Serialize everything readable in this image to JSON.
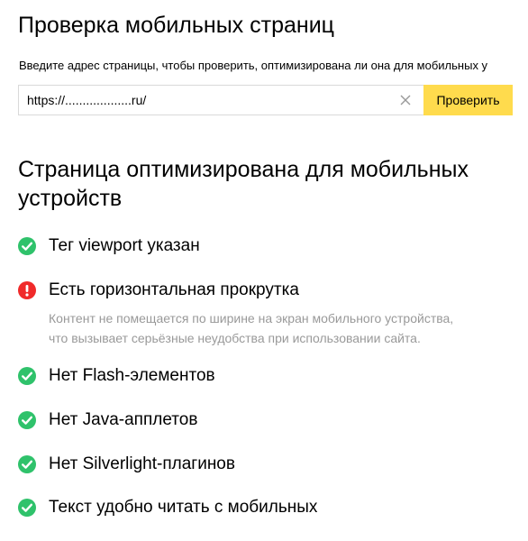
{
  "header": {
    "title": "Проверка мобильных страниц"
  },
  "form": {
    "instruction": "Введите адрес страницы, чтобы проверить, оптимизирована ли она для мобильных у",
    "url_value": "https://...................ru/",
    "clear_icon": "close-icon",
    "submit_label": "Проверить"
  },
  "result": {
    "title": "Страница оптимизирована для мобильных устройств",
    "checks": [
      {
        "status": "ok",
        "icon": "check-circle-icon",
        "label": "Тег viewport указан"
      },
      {
        "status": "error",
        "icon": "exclamation-circle-icon",
        "label": "Есть горизонтальная прокрутка",
        "description_line1": "Контент не помещается по ширине на экран мобильного устройства,",
        "description_line2": "что вызывает серьёзные неудобства при использовании сайта."
      },
      {
        "status": "ok",
        "icon": "check-circle-icon",
        "label": "Нет Flash-элементов"
      },
      {
        "status": "ok",
        "icon": "check-circle-icon",
        "label": "Нет Java-апплетов"
      },
      {
        "status": "ok",
        "icon": "check-circle-icon",
        "label": "Нет Silverlight-плагинов"
      },
      {
        "status": "ok",
        "icon": "check-circle-icon",
        "label": "Текст удобно читать с мобильных"
      }
    ]
  },
  "colors": {
    "success": "#2fc26b",
    "error": "#f02a2a",
    "button_bg": "#ffdb4d",
    "muted_text": "#999999",
    "border": "#d9d9d9"
  }
}
